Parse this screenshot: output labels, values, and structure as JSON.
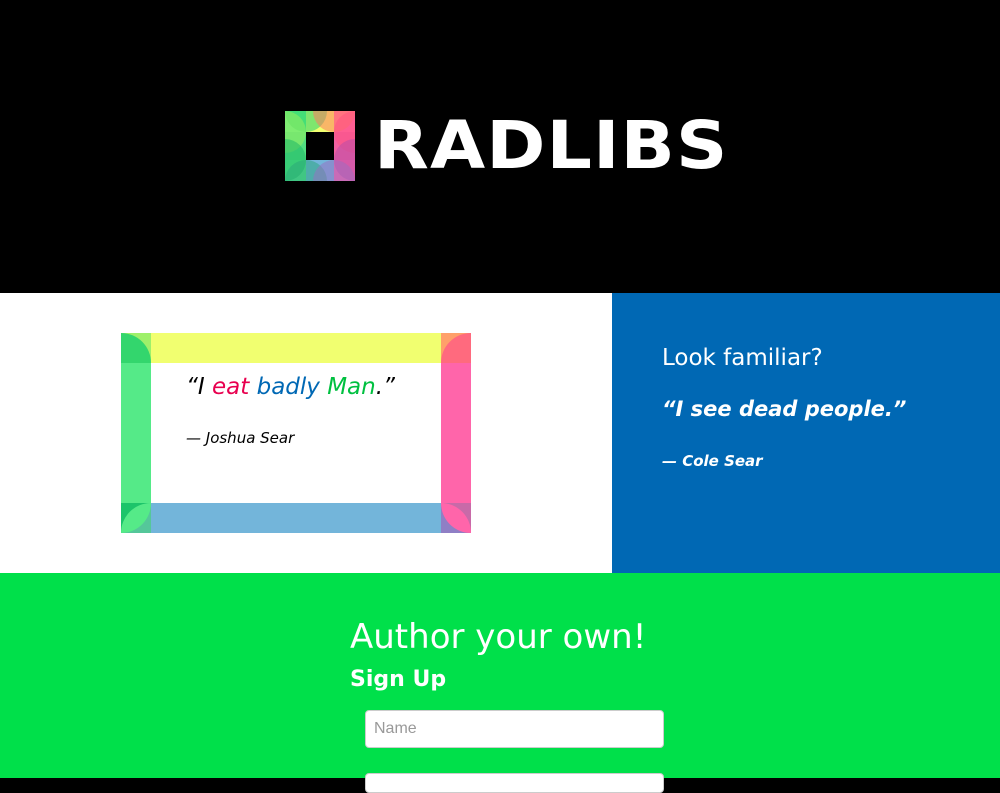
{
  "header": {
    "brand_name": "RADLIBS",
    "logo_icon": "radlibs-square-logo-icon"
  },
  "colors": {
    "header_bg": "#000000",
    "yellow": "#f1ff70",
    "pink": "#ff65aa",
    "blue_frame": "#73b5da",
    "green_frame": "#55ea88",
    "blue_panel": "#0068b4",
    "green_band": "#00e04a",
    "word_red": "#e8004f",
    "word_blue": "#0068b4",
    "word_green": "#00c040"
  },
  "example_card": {
    "open_quote": "“I ",
    "word1": "eat",
    "space1": " ",
    "word2": "badly",
    "space2": " ",
    "word3": "Man",
    "close_quote": ".”",
    "attribution": "— Joshua Sear"
  },
  "familiar_panel": {
    "heading": "Look familiar?",
    "quote": "“I see dead people.”",
    "attribution": "— Cole Sear"
  },
  "signup": {
    "title": "Author your own!",
    "subtitle": "Sign Up",
    "name_placeholder": "Name",
    "name_value": ""
  }
}
